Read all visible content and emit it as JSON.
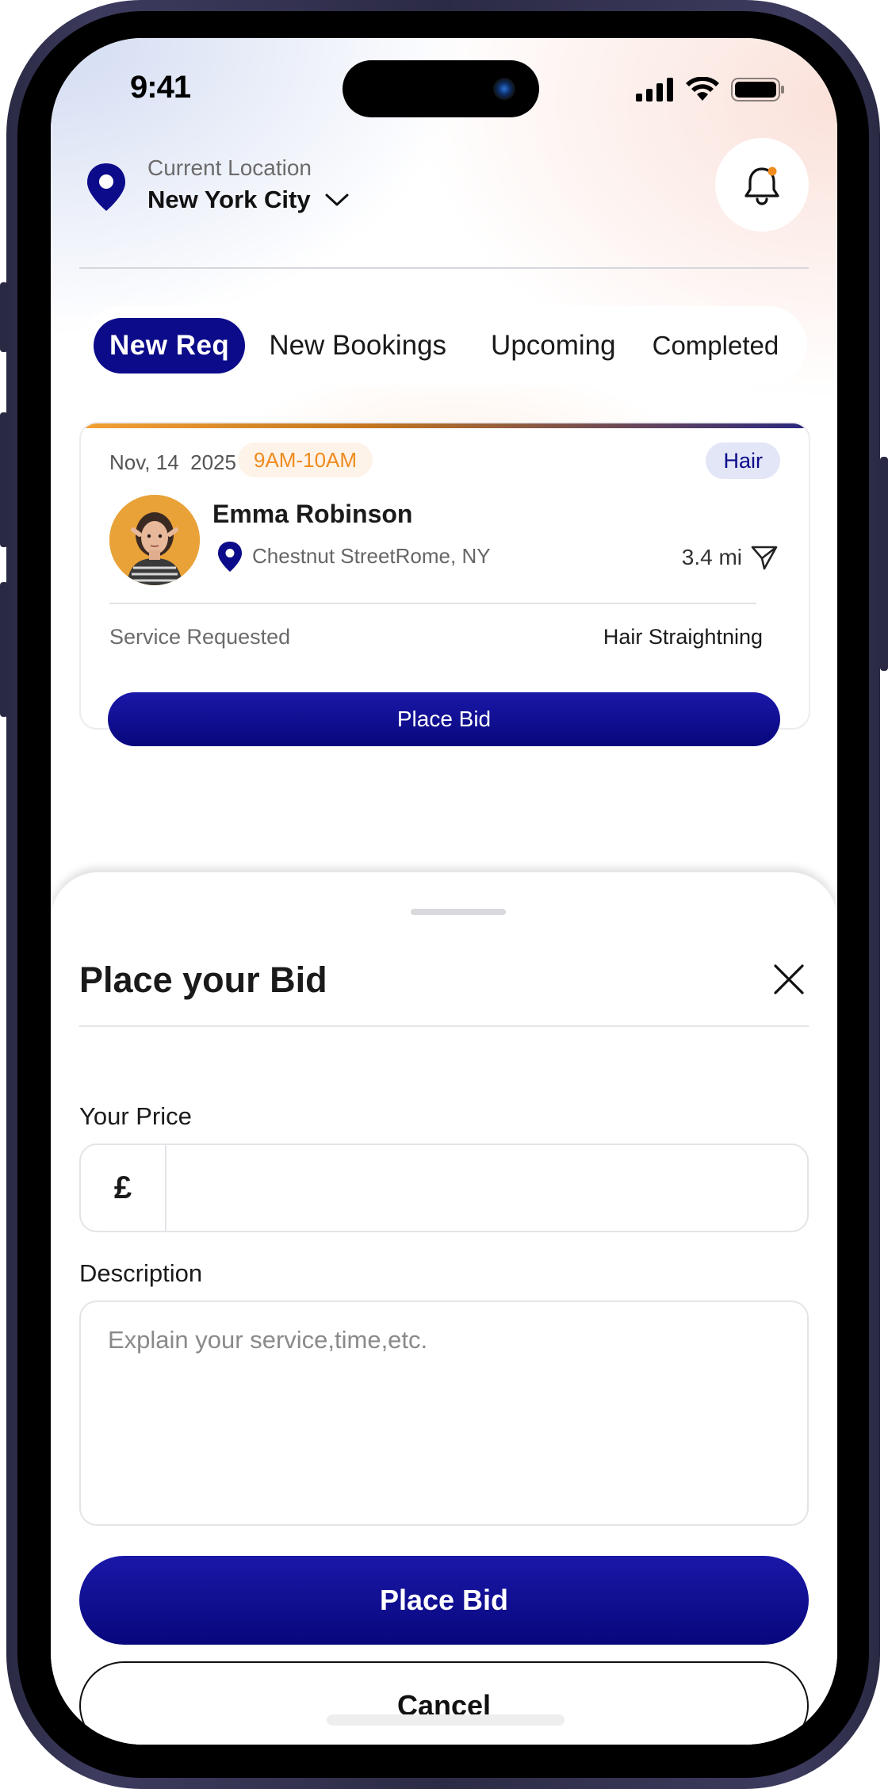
{
  "status_bar": {
    "time": "9:41"
  },
  "header": {
    "location_label": "Current Location",
    "location_value": "New York City",
    "icons": [
      "location-pin-icon",
      "chevron-down-icon",
      "bell-icon"
    ]
  },
  "tabs": [
    {
      "label": "New Req",
      "active": true
    },
    {
      "label": "New Bookings",
      "active": false
    },
    {
      "label": "Upcoming",
      "active": false
    },
    {
      "label": "Completed",
      "active": false
    }
  ],
  "request_card": {
    "date": "Nov, 14  2025",
    "time_slot": "9AM-10AM",
    "category": "Hair",
    "customer_name": "Emma Robinson",
    "address": "Chestnut StreetRome, NY",
    "distance": "3.4 mi",
    "service_label": "Service Requested",
    "service_value": "Hair Straightning",
    "button_label": "Place Bid"
  },
  "bid_sheet": {
    "title": "Place your Bid",
    "price_label": "Your Price",
    "currency_symbol": "£",
    "price_value": "",
    "description_label": "Description",
    "description_placeholder": "Explain your service,time,etc.",
    "submit_label": "Place Bid",
    "cancel_label": "Cancel"
  },
  "colors": {
    "primary": "#0c0b8a",
    "accent_orange": "#f08b1e",
    "tag_bg": "#e3e6f7",
    "chip_bg": "#fdf3e8"
  }
}
